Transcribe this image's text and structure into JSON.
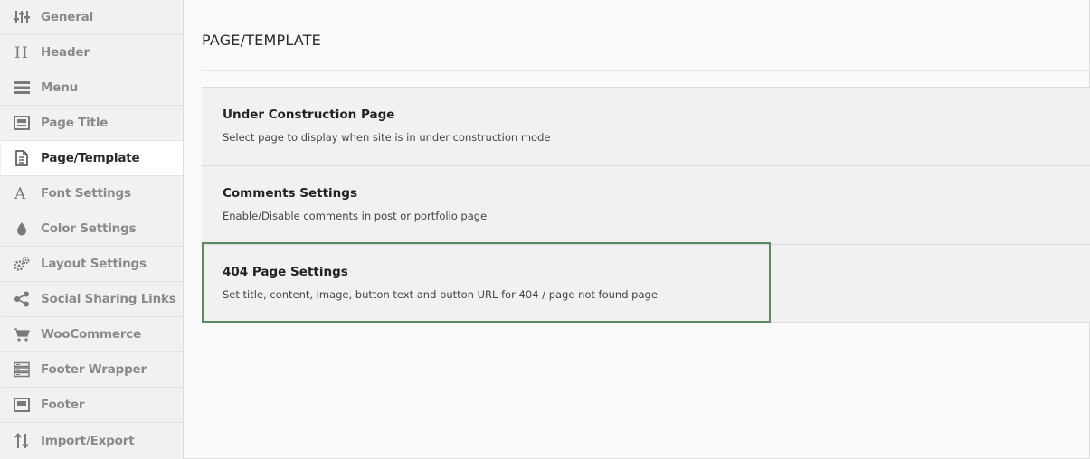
{
  "sidebar": {
    "items": [
      {
        "label": "General",
        "icon": "sliders-icon"
      },
      {
        "label": "Header",
        "icon": "header-h-icon"
      },
      {
        "label": "Menu",
        "icon": "menu-lines-icon"
      },
      {
        "label": "Page Title",
        "icon": "page-title-icon"
      },
      {
        "label": "Page/Template",
        "icon": "document-icon",
        "active": true
      },
      {
        "label": "Font Settings",
        "icon": "font-a-icon"
      },
      {
        "label": "Color Settings",
        "icon": "drop-icon"
      },
      {
        "label": "Layout Settings",
        "icon": "gears-icon"
      },
      {
        "label": "Social Sharing Links",
        "icon": "share-icon"
      },
      {
        "label": "WooCommerce",
        "icon": "cart-icon"
      },
      {
        "label": "Footer Wrapper",
        "icon": "footer-wrapper-icon"
      },
      {
        "label": "Footer",
        "icon": "footer-icon"
      },
      {
        "label": "Import/Export",
        "icon": "import-export-icon"
      }
    ]
  },
  "main": {
    "title": "PAGE/TEMPLATE",
    "sections": [
      {
        "title": "Under Construction Page",
        "description": "Select page to display when site is in under construction mode"
      },
      {
        "title": "Comments Settings",
        "description": "Enable/Disable comments in post or portfolio page"
      },
      {
        "title": "404 Page Settings",
        "description": "Set title, content, image, button text and button URL for 404 / page not found page"
      }
    ]
  },
  "colors": {
    "focus_border": "#5a8a5f",
    "sidebar_bg": "#f1f1f1",
    "active_bg": "#ffffff"
  }
}
